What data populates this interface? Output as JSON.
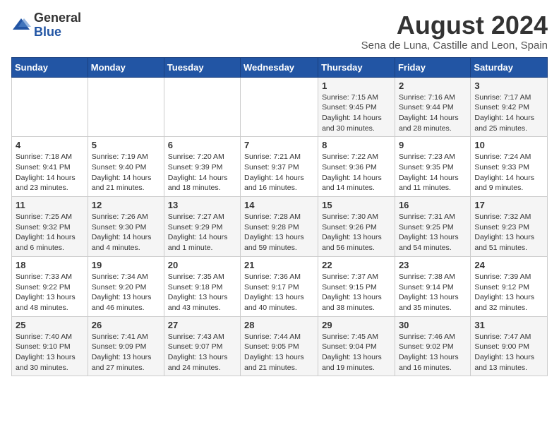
{
  "header": {
    "logo_general": "General",
    "logo_blue": "Blue",
    "month_year": "August 2024",
    "location": "Sena de Luna, Castille and Leon, Spain"
  },
  "days_of_week": [
    "Sunday",
    "Monday",
    "Tuesday",
    "Wednesday",
    "Thursday",
    "Friday",
    "Saturday"
  ],
  "weeks": [
    [
      {
        "day": "",
        "info": ""
      },
      {
        "day": "",
        "info": ""
      },
      {
        "day": "",
        "info": ""
      },
      {
        "day": "",
        "info": ""
      },
      {
        "day": "1",
        "info": "Sunrise: 7:15 AM\nSunset: 9:45 PM\nDaylight: 14 hours\nand 30 minutes."
      },
      {
        "day": "2",
        "info": "Sunrise: 7:16 AM\nSunset: 9:44 PM\nDaylight: 14 hours\nand 28 minutes."
      },
      {
        "day": "3",
        "info": "Sunrise: 7:17 AM\nSunset: 9:42 PM\nDaylight: 14 hours\nand 25 minutes."
      }
    ],
    [
      {
        "day": "4",
        "info": "Sunrise: 7:18 AM\nSunset: 9:41 PM\nDaylight: 14 hours\nand 23 minutes."
      },
      {
        "day": "5",
        "info": "Sunrise: 7:19 AM\nSunset: 9:40 PM\nDaylight: 14 hours\nand 21 minutes."
      },
      {
        "day": "6",
        "info": "Sunrise: 7:20 AM\nSunset: 9:39 PM\nDaylight: 14 hours\nand 18 minutes."
      },
      {
        "day": "7",
        "info": "Sunrise: 7:21 AM\nSunset: 9:37 PM\nDaylight: 14 hours\nand 16 minutes."
      },
      {
        "day": "8",
        "info": "Sunrise: 7:22 AM\nSunset: 9:36 PM\nDaylight: 14 hours\nand 14 minutes."
      },
      {
        "day": "9",
        "info": "Sunrise: 7:23 AM\nSunset: 9:35 PM\nDaylight: 14 hours\nand 11 minutes."
      },
      {
        "day": "10",
        "info": "Sunrise: 7:24 AM\nSunset: 9:33 PM\nDaylight: 14 hours\nand 9 minutes."
      }
    ],
    [
      {
        "day": "11",
        "info": "Sunrise: 7:25 AM\nSunset: 9:32 PM\nDaylight: 14 hours\nand 6 minutes."
      },
      {
        "day": "12",
        "info": "Sunrise: 7:26 AM\nSunset: 9:30 PM\nDaylight: 14 hours\nand 4 minutes."
      },
      {
        "day": "13",
        "info": "Sunrise: 7:27 AM\nSunset: 9:29 PM\nDaylight: 14 hours\nand 1 minute."
      },
      {
        "day": "14",
        "info": "Sunrise: 7:28 AM\nSunset: 9:28 PM\nDaylight: 13 hours\nand 59 minutes."
      },
      {
        "day": "15",
        "info": "Sunrise: 7:30 AM\nSunset: 9:26 PM\nDaylight: 13 hours\nand 56 minutes."
      },
      {
        "day": "16",
        "info": "Sunrise: 7:31 AM\nSunset: 9:25 PM\nDaylight: 13 hours\nand 54 minutes."
      },
      {
        "day": "17",
        "info": "Sunrise: 7:32 AM\nSunset: 9:23 PM\nDaylight: 13 hours\nand 51 minutes."
      }
    ],
    [
      {
        "day": "18",
        "info": "Sunrise: 7:33 AM\nSunset: 9:22 PM\nDaylight: 13 hours\nand 48 minutes."
      },
      {
        "day": "19",
        "info": "Sunrise: 7:34 AM\nSunset: 9:20 PM\nDaylight: 13 hours\nand 46 minutes."
      },
      {
        "day": "20",
        "info": "Sunrise: 7:35 AM\nSunset: 9:18 PM\nDaylight: 13 hours\nand 43 minutes."
      },
      {
        "day": "21",
        "info": "Sunrise: 7:36 AM\nSunset: 9:17 PM\nDaylight: 13 hours\nand 40 minutes."
      },
      {
        "day": "22",
        "info": "Sunrise: 7:37 AM\nSunset: 9:15 PM\nDaylight: 13 hours\nand 38 minutes."
      },
      {
        "day": "23",
        "info": "Sunrise: 7:38 AM\nSunset: 9:14 PM\nDaylight: 13 hours\nand 35 minutes."
      },
      {
        "day": "24",
        "info": "Sunrise: 7:39 AM\nSunset: 9:12 PM\nDaylight: 13 hours\nand 32 minutes."
      }
    ],
    [
      {
        "day": "25",
        "info": "Sunrise: 7:40 AM\nSunset: 9:10 PM\nDaylight: 13 hours\nand 30 minutes."
      },
      {
        "day": "26",
        "info": "Sunrise: 7:41 AM\nSunset: 9:09 PM\nDaylight: 13 hours\nand 27 minutes."
      },
      {
        "day": "27",
        "info": "Sunrise: 7:43 AM\nSunset: 9:07 PM\nDaylight: 13 hours\nand 24 minutes."
      },
      {
        "day": "28",
        "info": "Sunrise: 7:44 AM\nSunset: 9:05 PM\nDaylight: 13 hours\nand 21 minutes."
      },
      {
        "day": "29",
        "info": "Sunrise: 7:45 AM\nSunset: 9:04 PM\nDaylight: 13 hours\nand 19 minutes."
      },
      {
        "day": "30",
        "info": "Sunrise: 7:46 AM\nSunset: 9:02 PM\nDaylight: 13 hours\nand 16 minutes."
      },
      {
        "day": "31",
        "info": "Sunrise: 7:47 AM\nSunset: 9:00 PM\nDaylight: 13 hours\nand 13 minutes."
      }
    ]
  ]
}
